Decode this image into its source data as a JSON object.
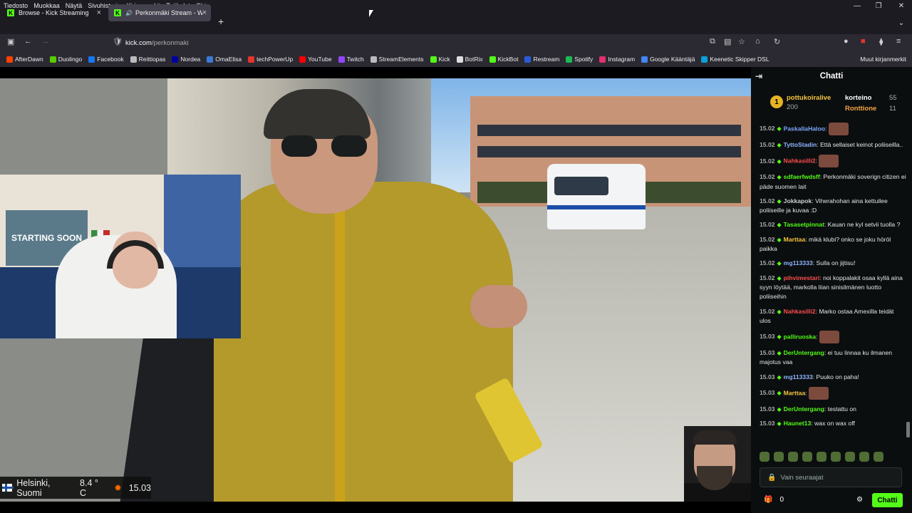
{
  "menubar": {
    "items": [
      "Tiedosto",
      "Muokkaa",
      "Näytä",
      "Sivuhistoria",
      "Kirjanmerkit",
      "Työkalut",
      "Ohje"
    ]
  },
  "tabs": [
    {
      "title": "Browse - Kick Streaming",
      "close": "×"
    },
    {
      "title": "Perkonmäki Stream - Watc",
      "close": "×"
    }
  ],
  "newtab": "+",
  "url": {
    "domain": "kick.com",
    "path": "/perkonmaki"
  },
  "bookmarks": [
    {
      "label": "AfterDawn",
      "color": "#ff4000"
    },
    {
      "label": "Duolingo",
      "color": "#58cc02"
    },
    {
      "label": "Facebook",
      "color": "#1877f2"
    },
    {
      "label": "Reittiopas",
      "color": "#bbbbbb"
    },
    {
      "label": "Nordea",
      "color": "#0000a0"
    },
    {
      "label": "OmaElisa",
      "color": "#3a7bd5"
    },
    {
      "label": "techPowerUp",
      "color": "#e5352c"
    },
    {
      "label": "YouTube",
      "color": "#ff0000"
    },
    {
      "label": "Twitch",
      "color": "#9146ff"
    },
    {
      "label": "StreamElements",
      "color": "#bbbbbb"
    },
    {
      "label": "Kick",
      "color": "#53fc18"
    },
    {
      "label": "BotRix",
      "color": "#dddddd"
    },
    {
      "label": "KickBot",
      "color": "#53fc18"
    },
    {
      "label": "Restream",
      "color": "#2a5bd7"
    },
    {
      "label": "Spotify",
      "color": "#1db954"
    },
    {
      "label": "Instagram",
      "color": "#e1306c"
    },
    {
      "label": "Google Kääntäjä",
      "color": "#4285f4"
    },
    {
      "label": "Keenetic Skipper DSL",
      "color": "#0aa0d8"
    }
  ],
  "bookmarks_other": "Muut kirjanmerkit",
  "video": {
    "poster_text": "STARTING SOON",
    "weather": {
      "place": "Helsinki, Suomi",
      "temp": "8.4 ° C",
      "time": "15.03"
    }
  },
  "chat": {
    "title": "Chatti",
    "pinned": [
      {
        "user": "pottukoiralive",
        "amount": "200"
      },
      {
        "user": "korteino",
        "amount": "55"
      },
      {
        "user": "Ronttione",
        "amount": "11"
      }
    ],
    "medal": "1",
    "messages": [
      {
        "time": "15.02",
        "user": "PaskallaHaloo",
        "color": "#7ea7ff",
        "text": "",
        "emote": true
      },
      {
        "time": "15.02",
        "user": "TyttoStadin",
        "color": "#8fb6ff",
        "text": "Että sellaiset keinot poliiseilla..",
        "emote": false
      },
      {
        "time": "15.02",
        "user": "Nahkasilli2",
        "color": "#ff4d4d",
        "text": "",
        "emote": true
      },
      {
        "time": "15.02",
        "user": "sdfaerfwdsff",
        "color": "#53fc18",
        "text": "Perkonmäki soverign citizen ei päde suomen lait",
        "emote": false
      },
      {
        "time": "15.02",
        "user": "Jokkapok",
        "color": "#cfcfcf",
        "text": "Viherahohan aina kettuilee poliiseille ja kuvaa :D",
        "emote": false
      },
      {
        "time": "15.02",
        "user": "Tasasetpinnat",
        "color": "#53fc18",
        "text": "Kauan ne kyl setvii tuolla ?",
        "emote": false
      },
      {
        "time": "15.02",
        "user": "Marttaa",
        "color": "#f5c542",
        "text": "mikä klubi? onko se joku höröl paikka",
        "emote": false
      },
      {
        "time": "15.02",
        "user": "mg113333",
        "color": "#8fb6ff",
        "text": "Sulla on jijtisu!",
        "emote": false
      },
      {
        "time": "15.02",
        "user": "pihvimestari",
        "color": "#ff4d4d",
        "text": "noi koppalakit osaa kyllä aina syyn löytää, markolla liian sinisilmänen luotto poliiseihin",
        "emote": false
      },
      {
        "time": "15.02",
        "user": "Nahkasilli2",
        "color": "#ff4d4d",
        "text": "Marko ostaa Amexilla teidät ulos",
        "emote": false
      },
      {
        "time": "15.03",
        "user": "palliruoska",
        "color": "#53fc18",
        "text": "",
        "emote": true
      },
      {
        "time": "15.03",
        "user": "DerUntergang",
        "color": "#53fc18",
        "text": "ei tuu linnaa ku ilmanen majotus vaa",
        "emote": false
      },
      {
        "time": "15.03",
        "user": "mg113333",
        "color": "#8fb6ff",
        "text": "Puuko on paha!",
        "emote": false
      },
      {
        "time": "15.03",
        "user": "Marttaa",
        "color": "#f5c542",
        "text": "",
        "emote": true
      },
      {
        "time": "15.03",
        "user": "DerUntergang",
        "color": "#53fc18",
        "text": "testattu on",
        "emote": false
      },
      {
        "time": "15.03",
        "user": "Haunet13",
        "color": "#53fc18",
        "text": "wax on wax off",
        "emote": false
      }
    ],
    "input_placeholder": "Vain seuraajat",
    "count": "0",
    "send_label": "Chatti"
  },
  "colors": {
    "kick_green": "#53fc18",
    "bg": "#0b0e0f"
  }
}
